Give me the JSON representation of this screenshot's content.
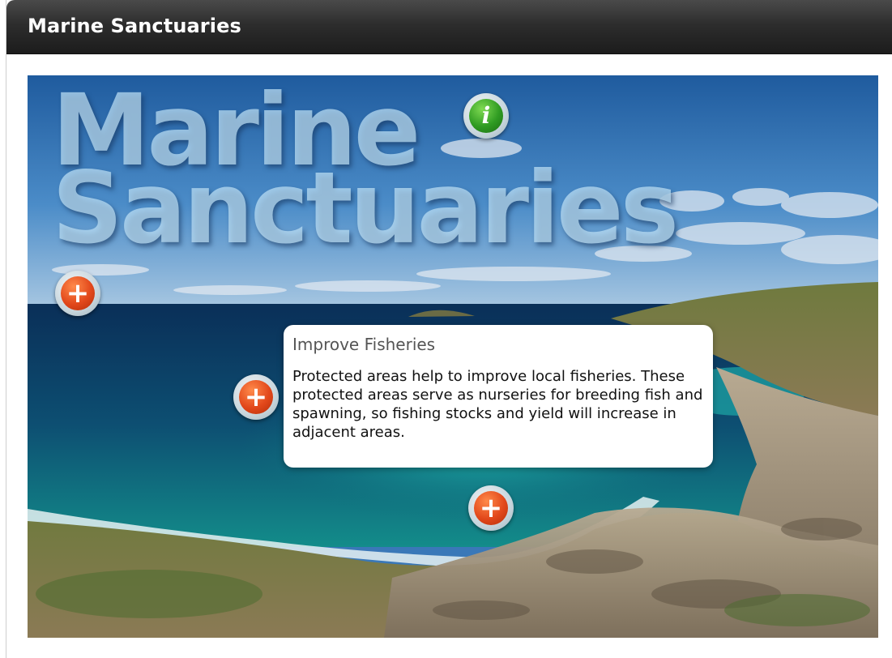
{
  "window": {
    "title": "Marine Sanctuaries"
  },
  "scene": {
    "heading_line1": "Marine",
    "heading_line2": "Sanctuaries",
    "hotspots": [
      {
        "name": "info-hotspot",
        "icon": "info-icon",
        "glyph": "i"
      },
      {
        "name": "plus-hotspot-left",
        "icon": "plus-icon",
        "glyph": "+"
      },
      {
        "name": "plus-hotspot-center",
        "icon": "plus-icon",
        "glyph": "+"
      },
      {
        "name": "plus-hotspot-bottom",
        "icon": "plus-icon",
        "glyph": "+"
      }
    ]
  },
  "popup": {
    "title": "Improve Fisheries",
    "body": "Protected areas help to improve local fisheries. These protected areas serve as nurseries for breeding fish and spawning, so fishing stocks and yield will increase in adjacent areas."
  },
  "colors": {
    "titlebar": "#2d2d2d",
    "hotspot_orange": "#e2481b",
    "hotspot_green": "#2f9b22",
    "sea": "#0b3b66",
    "lagoon": "#1aa3a0"
  }
}
